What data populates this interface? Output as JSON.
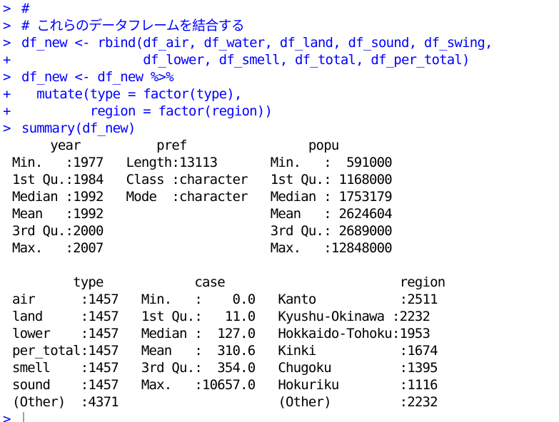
{
  "console": {
    "prompt_primary": ">",
    "prompt_continuation": "+",
    "commands": [
      {
        "prompt": ">",
        "text": "#"
      },
      {
        "prompt": ">",
        "text": "# これらのデータフレームを結合する"
      },
      {
        "prompt": ">",
        "text": "df_new <- rbind(df_air, df_water, df_land, df_sound, df_swing,"
      },
      {
        "prompt": "+",
        "text": "                df_lower, df_smell, df_total, df_per_total)"
      },
      {
        "prompt": ">",
        "text": "df_new <- df_new %>%"
      },
      {
        "prompt": "+",
        "text": "  mutate(type = factor(type),"
      },
      {
        "prompt": "+",
        "text": "         region = factor(region))"
      },
      {
        "prompt": ">",
        "text": "summary(df_new)"
      }
    ],
    "summary_output": [
      "     year          pref                popu         ",
      "Min.   :1977   Length:13113       Min.   :  591000  ",
      "1st Qu.:1984   Class :character   1st Qu.: 1168000  ",
      "Median :1992   Mode  :character   Median : 1753179  ",
      "Mean   :1992                      Mean   : 2624604  ",
      "3rd Qu.:2000                      3rd Qu.: 2689000  ",
      "Max.   :2007                      Max.   :12848000  ",
      "",
      "        type            case                       region    ",
      "air      :1457   Min.   :    0.0   Kanto           :2511  ",
      "land     :1457   1st Qu.:   11.0   Kyushu-Okinawa :2232  ",
      "lower    :1457   Median :  127.0   Hokkaido-Tohoku:1953  ",
      "per_total:1457   Mean   :  310.6   Kinki           :1674  ",
      "smell    :1457   3rd Qu.:  354.0   Chugoku         :1395  ",
      "sound    :1457   Max.   :10657.0   Hokuriku        :1116  ",
      "(Other)  :4371                     (Other)         :2232  "
    ],
    "final_prompt": ">"
  },
  "colors": {
    "command": "#0000ff",
    "output": "#000000",
    "background": "#ffffff",
    "cursor": "#a0a0a0"
  }
}
